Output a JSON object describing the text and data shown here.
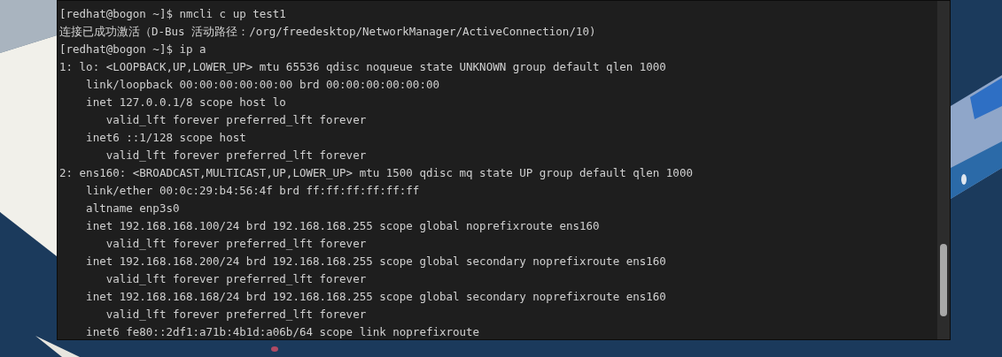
{
  "terminal": {
    "lines": [
      "[redhat@bogon ~]$ nmcli c up test1",
      "连接已成功激活（D-Bus 活动路径：/org/freedesktop/NetworkManager/ActiveConnection/10)",
      "[redhat@bogon ~]$ ip a",
      "1: lo: <LOOPBACK,UP,LOWER_UP> mtu 65536 qdisc noqueue state UNKNOWN group default qlen 1000",
      "    link/loopback 00:00:00:00:00:00 brd 00:00:00:00:00:00",
      "    inet 127.0.0.1/8 scope host lo",
      "       valid_lft forever preferred_lft forever",
      "    inet6 ::1/128 scope host",
      "       valid_lft forever preferred_lft forever",
      "2: ens160: <BROADCAST,MULTICAST,UP,LOWER_UP> mtu 1500 qdisc mq state UP group default qlen 1000",
      "    link/ether 00:0c:29:b4:56:4f brd ff:ff:ff:ff:ff:ff",
      "    altname enp3s0",
      "    inet 192.168.168.100/24 brd 192.168.168.255 scope global noprefixroute ens160",
      "       valid_lft forever preferred_lft forever",
      "    inet 192.168.168.200/24 brd 192.168.168.255 scope global secondary noprefixroute ens160",
      "       valid_lft forever preferred_lft forever",
      "    inet 192.168.168.168/24 brd 192.168.168.255 scope global secondary noprefixroute ens160",
      "       valid_lft forever preferred_lft forever",
      "    inet6 fe80::2df1:a71b:4b1d:a06b/64 scope link noprefixroute"
    ]
  }
}
